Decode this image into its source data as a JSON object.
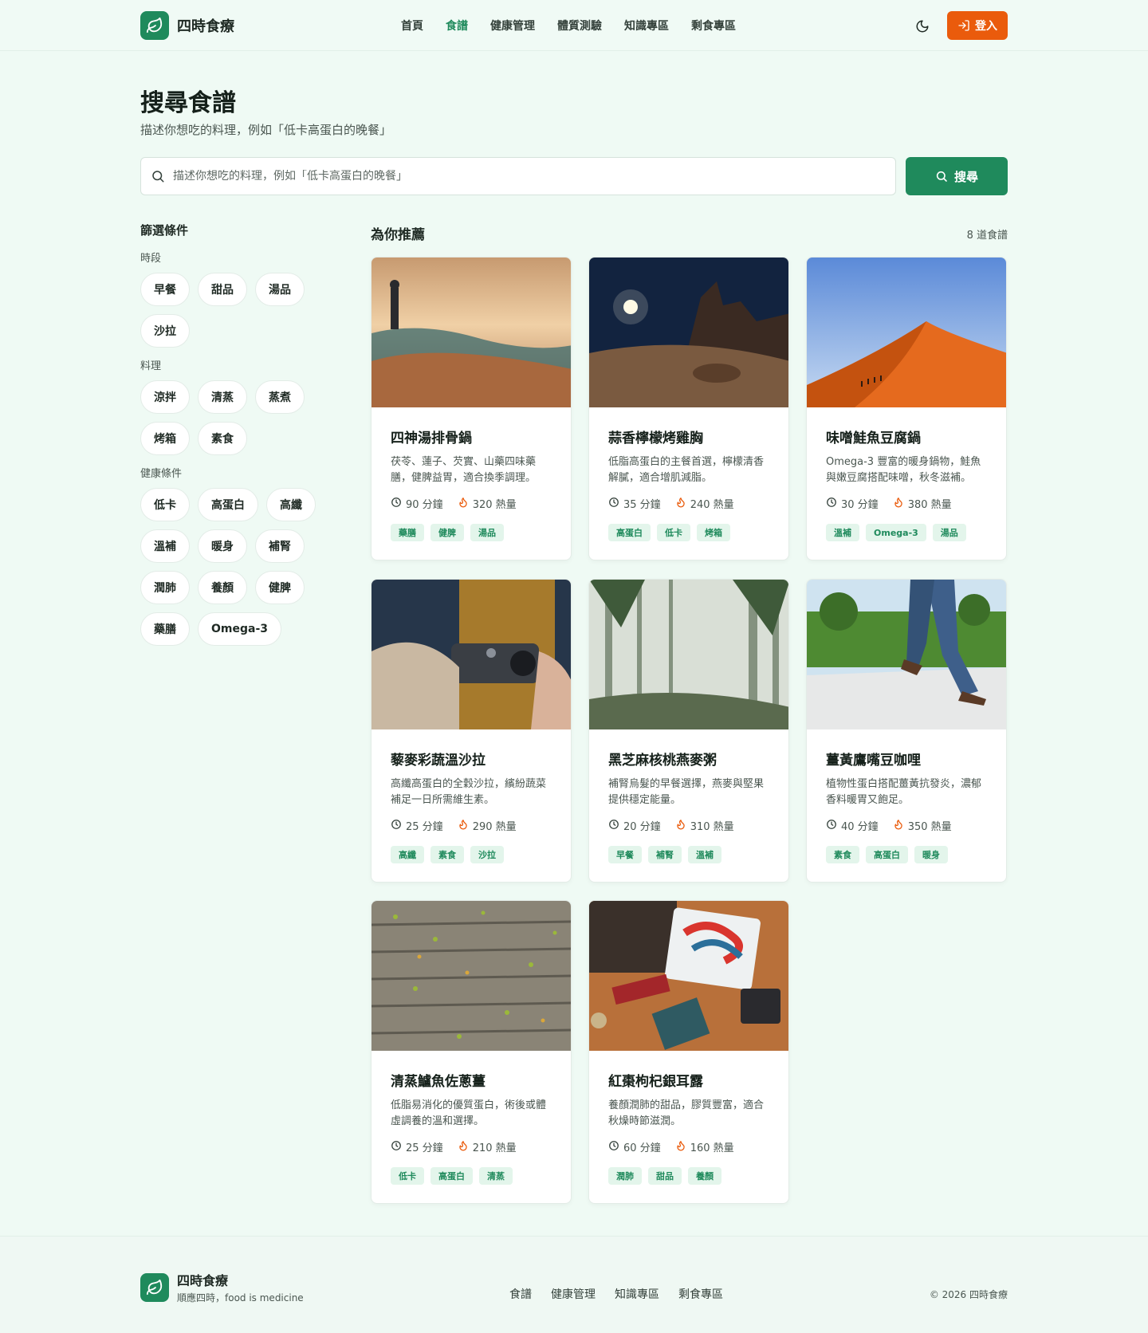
{
  "header": {
    "brand": "四時食療",
    "nav": [
      {
        "label": "首頁",
        "active": false
      },
      {
        "label": "食譜",
        "active": true
      },
      {
        "label": "健康管理",
        "active": false
      },
      {
        "label": "體質測驗",
        "active": false
      },
      {
        "label": "知識專區",
        "active": false
      },
      {
        "label": "剩食專區",
        "active": false
      }
    ],
    "theme_icon": "moon-icon",
    "login_label": "登入"
  },
  "page": {
    "title": "搜尋食譜",
    "subtitle": "描述你想吃的料理，例如「低卡高蛋白的晚餐」"
  },
  "search": {
    "placeholder": "描述你想吃的料理，例如「低卡高蛋白的晚餐」",
    "value": "",
    "button_label": "搜尋"
  },
  "filters": {
    "heading": "篩選條件",
    "groups": [
      {
        "label": "時段",
        "chips": [
          "早餐",
          "甜品",
          "湯品",
          "沙拉"
        ]
      },
      {
        "label": "料理",
        "chips": [
          "涼拌",
          "清蒸",
          "蒸煮",
          "烤箱",
          "素食"
        ]
      },
      {
        "label": "健康條件",
        "chips": [
          "低卡",
          "高蛋白",
          "高纖",
          "溫補",
          "暖身",
          "補腎",
          "潤肺",
          "養顏",
          "健脾",
          "藥膳",
          "Omega-3"
        ]
      }
    ]
  },
  "results": {
    "title": "為你推薦",
    "count": "8 道食譜",
    "cards": [
      {
        "title": "四神湯排骨鍋",
        "desc": "茯苓、蓮子、芡實、山藥四味藥膳，健脾益胃，適合換季調理。",
        "time": "90 分鐘",
        "cal": "320 熱量",
        "tags": [
          "藥膳",
          "健脾",
          "湯品"
        ],
        "image": "sea-cliff-photo"
      },
      {
        "title": "蒜香檸檬烤雞胸",
        "desc": "低脂高蛋白的主餐首選，檸檬清香解膩，適合增肌減脂。",
        "time": "35 分鐘",
        "cal": "240 熱量",
        "tags": [
          "高蛋白",
          "低卡",
          "烤箱"
        ],
        "image": "night-desert-photo"
      },
      {
        "title": "味噌鮭魚豆腐鍋",
        "desc": "Omega-3 豐富的暖身鍋物，鮭魚與嫩豆腐搭配味噌，秋冬滋補。",
        "time": "30 分鐘",
        "cal": "380 熱量",
        "tags": [
          "溫補",
          "Omega-3",
          "湯品"
        ],
        "image": "sand-dune-photo"
      },
      {
        "title": "藜麥彩蔬溫沙拉",
        "desc": "高纖高蛋白的全穀沙拉，繽紛蔬菜補足一日所需維生素。",
        "time": "25 分鐘",
        "cal": "290 熱量",
        "tags": [
          "高纖",
          "素食",
          "沙拉"
        ],
        "image": "camera-hands-photo"
      },
      {
        "title": "黑芝麻核桃燕麥粥",
        "desc": "補腎烏髮的早餐選擇，燕麥與堅果提供穩定能量。",
        "time": "20 分鐘",
        "cal": "310 熱量",
        "tags": [
          "早餐",
          "補腎",
          "溫補"
        ],
        "image": "misty-forest-photo"
      },
      {
        "title": "薑黃鷹嘴豆咖哩",
        "desc": "植物性蛋白搭配薑黃抗發炎，濃郁香料暖胃又飽足。",
        "time": "40 分鐘",
        "cal": "350 熱量",
        "tags": [
          "素食",
          "高蛋白",
          "暖身"
        ],
        "image": "walking-legs-photo"
      },
      {
        "title": "清蒸鱸魚佐蔥薑",
        "desc": "低脂易消化的優質蛋白，術後或體虛調養的溫和選擇。",
        "time": "25 分鐘",
        "cal": "210 熱量",
        "tags": [
          "低卡",
          "高蛋白",
          "清蒸"
        ],
        "image": "wood-deck-leaves-photo"
      },
      {
        "title": "紅棗枸杞銀耳露",
        "desc": "養顏潤肺的甜品，膠質豐富，適合秋燥時節滋潤。",
        "time": "60 分鐘",
        "cal": "160 熱量",
        "tags": [
          "潤肺",
          "甜品",
          "養顏"
        ],
        "image": "desk-items-photo"
      }
    ]
  },
  "footer": {
    "brand": "四時食療",
    "slogan": "順應四時，food is medicine",
    "nav": [
      "食譜",
      "健康管理",
      "知識專區",
      "剩食專區"
    ],
    "copyright": "© 2026 四時食療"
  },
  "colors": {
    "primary": "#1f8a5c",
    "accent": "#ea5b0c",
    "background": "#effaf4",
    "tag_bg": "#e3f5eb"
  }
}
